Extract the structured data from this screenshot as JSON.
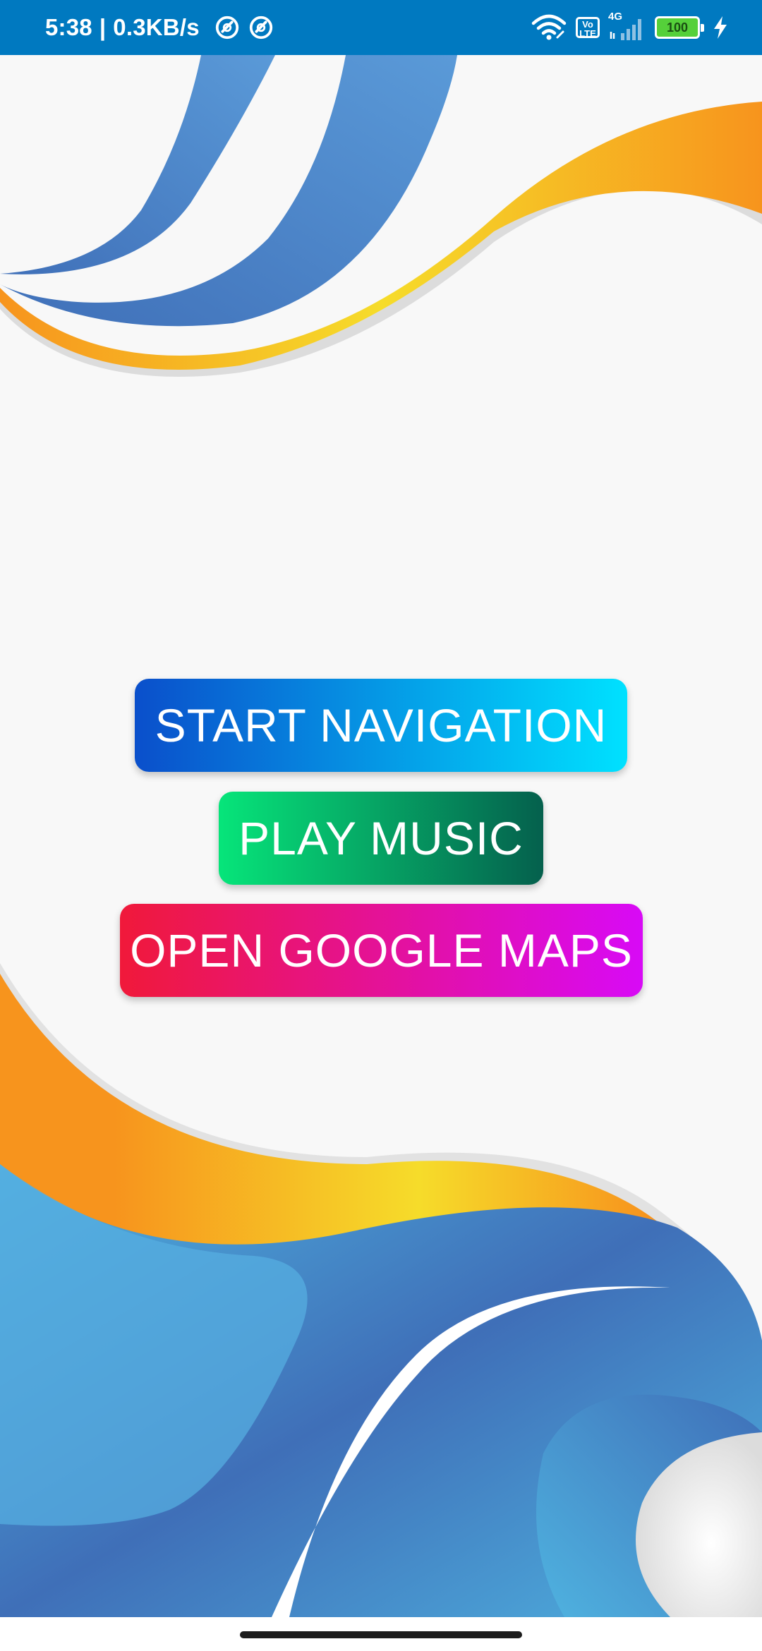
{
  "status_bar": {
    "time": "5:38",
    "separator": "|",
    "speed": "0.3KB/s",
    "network_type": "4G",
    "volte_line1": "Vo",
    "volte_line2": "LTE",
    "battery_level": "100",
    "icons": [
      "hotspot-icon",
      "hotspot-icon",
      "wifi-icon",
      "volte-icon",
      "signal-icon",
      "battery-icon",
      "charging-icon"
    ],
    "background_color": "#0079c0"
  },
  "actions": {
    "start_navigation": "START NAVIGATION",
    "play_music": "PLAY MUSIC",
    "open_google_maps": "OPEN GOOGLE MAPS"
  },
  "colors": {
    "background": "#f8f8f8",
    "wave_blue": "#3f6fb8",
    "wave_light_blue": "#4fb3e0",
    "wave_orange": "#f7941d",
    "wave_yellow": "#f6dc2a",
    "nav_gradient": [
      "#0a4fcb",
      "#00e1ff"
    ],
    "music_gradient": [
      "#06e57a",
      "#05604d"
    ],
    "maps_gradient": [
      "#f0193a",
      "#d80af6"
    ]
  }
}
